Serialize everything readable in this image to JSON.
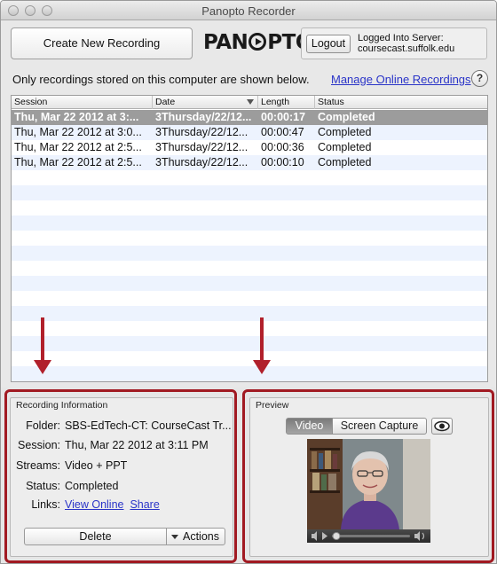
{
  "window": {
    "title": "Panopto Recorder"
  },
  "toolbar": {
    "create_button": "Create New Recording",
    "logo_pre": "PAN",
    "logo_post": "PTO",
    "logout_button": "Logout",
    "server_label": "Logged Into Server:",
    "server_name": "coursecast.suffolk.edu"
  },
  "notice": {
    "text": "Only recordings stored on this computer are shown below.",
    "manage_link": "Manage Online Recordings",
    "help": "?"
  },
  "table": {
    "columns": [
      "Session",
      "Date",
      "Length",
      "Status"
    ],
    "rows": [
      {
        "session": "Thu, Mar 22 2012 at 3:...",
        "date": "3Thursday/22/12...",
        "length": "00:00:17",
        "status": "Completed",
        "selected": true
      },
      {
        "session": "Thu, Mar 22 2012 at 3:0...",
        "date": "3Thursday/22/12...",
        "length": "00:00:47",
        "status": "Completed",
        "selected": false
      },
      {
        "session": "Thu, Mar 22 2012 at 2:5...",
        "date": "3Thursday/22/12...",
        "length": "00:00:36",
        "status": "Completed",
        "selected": false
      },
      {
        "session": "Thu, Mar 22 2012 at 2:5...",
        "date": "3Thursday/22/12...",
        "length": "00:00:10",
        "status": "Completed",
        "selected": false
      }
    ]
  },
  "recording_info": {
    "title": "Recording Information",
    "folder_label": "Folder:",
    "folder_value": "SBS-EdTech-CT: CourseCast Tr...",
    "session_label": "Session:",
    "session_value": "Thu, Mar 22 2012 at 3:11 PM",
    "streams_label": "Streams:",
    "streams_value": "Video + PPT",
    "status_label": "Status:",
    "status_value": "Completed",
    "links_label": "Links:",
    "view_online": "View Online",
    "share": "Share",
    "delete_button": "Delete",
    "actions_button": "Actions"
  },
  "preview": {
    "title": "Preview",
    "tab_video": "Video",
    "tab_screen": "Screen Capture",
    "active_tab": "Video"
  },
  "colors": {
    "annotation": "#a11a22",
    "link": "#2a34c8",
    "selected_row": "#9c9c9c",
    "row_stripe": "#edf3fe"
  }
}
